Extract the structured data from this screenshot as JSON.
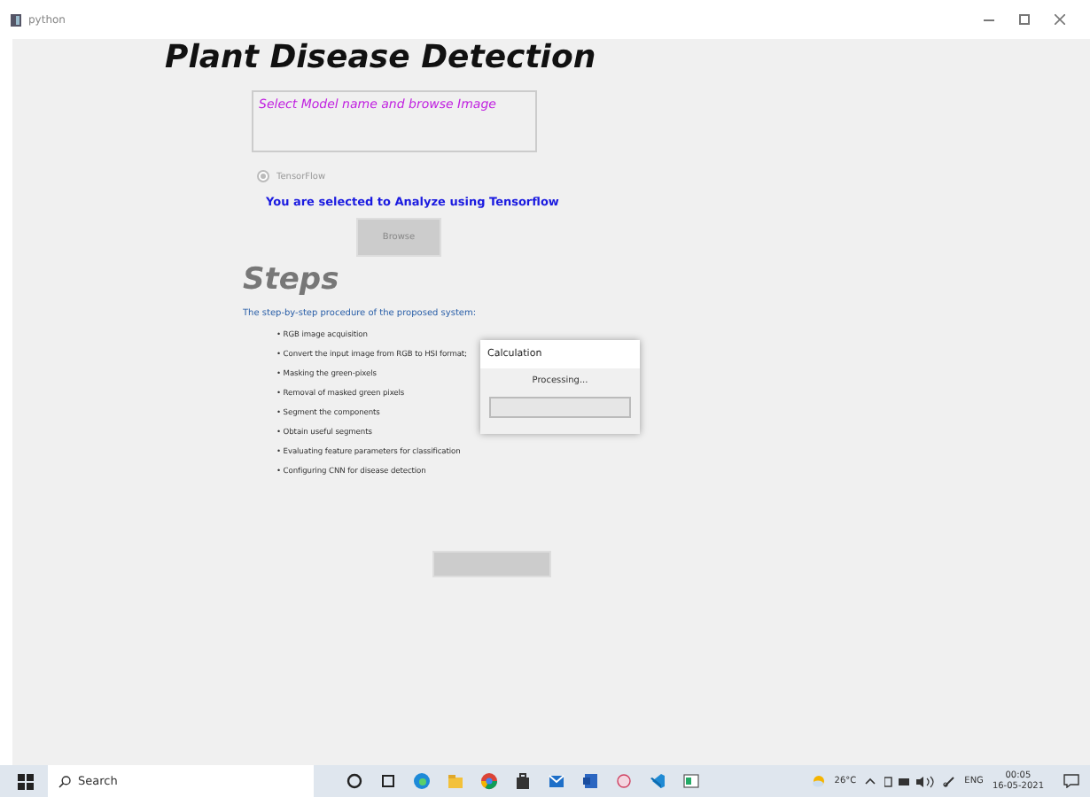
{
  "window": {
    "title": "python"
  },
  "app": {
    "heading": "Plant Disease Detection",
    "info_box": {
      "value": "Select Model name and browse Image"
    },
    "radio": {
      "label": "TensorFlow",
      "checked": true,
      "disabled": true
    },
    "status": "You are selected to Analyze using Tensorflow",
    "browse_button": "Browse",
    "steps_heading": "Steps",
    "intro": "The step-by-step procedure of the proposed system:",
    "steps": [
      "• RGB image acquisition",
      "• Convert the input image from RGB to HSI format;",
      "• Masking the green-pixels",
      "• Removal of masked green pixels",
      "• Segment the components",
      "• Obtain useful segments",
      "• Evaluating feature parameters for classification",
      "• Configuring CNN for disease detection"
    ]
  },
  "dialog": {
    "title": "Calculation",
    "message": "Processing..."
  },
  "taskbar": {
    "search": {
      "placeholder": "Search"
    },
    "weather": "26°C",
    "language": "ENG",
    "time": "00:05",
    "date": "16-05-2021"
  }
}
